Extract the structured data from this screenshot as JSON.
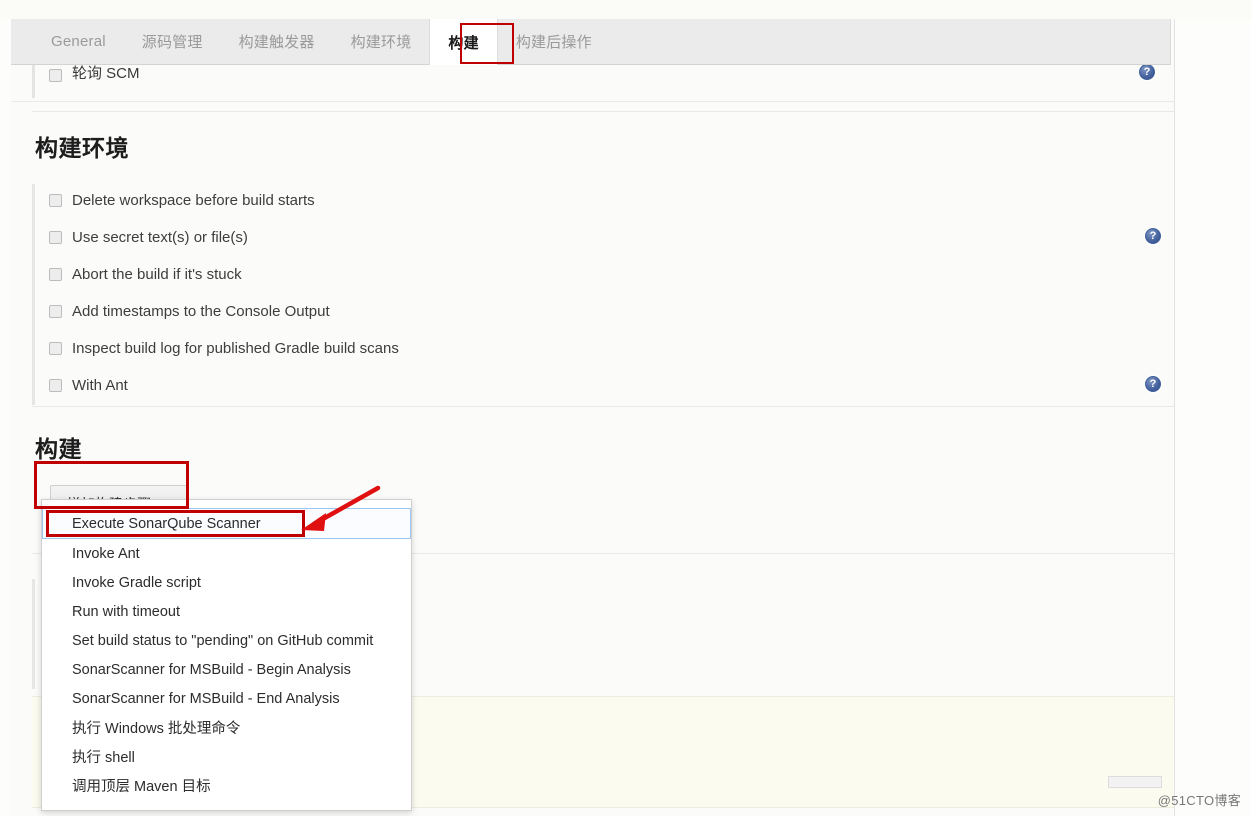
{
  "tabs": [
    {
      "label": "General",
      "active": false
    },
    {
      "label": "源码管理",
      "active": false
    },
    {
      "label": "构建触发器",
      "active": false
    },
    {
      "label": "构建环境",
      "active": false
    },
    {
      "label": "构建",
      "active": true
    },
    {
      "label": "构建后操作",
      "active": false
    }
  ],
  "clipped_row": {
    "label": "轮询 SCM",
    "help_icon": "help-question-icon"
  },
  "sections": {
    "build_environment": {
      "title": "构建环境",
      "checkboxes": [
        {
          "label": "Delete workspace before build starts",
          "checked": false,
          "help": false
        },
        {
          "label": "Use secret text(s) or file(s)",
          "checked": false,
          "help": true
        },
        {
          "label": "Abort the build if it's stuck",
          "checked": false,
          "help": false
        },
        {
          "label": "Add timestamps to the Console Output",
          "checked": false,
          "help": false
        },
        {
          "label": "Inspect build log for published Gradle build scans",
          "checked": false,
          "help": false
        },
        {
          "label": "With Ant",
          "checked": false,
          "help": true
        }
      ]
    },
    "build": {
      "title": "构建",
      "add_step_button": {
        "label": "增加构建步骤",
        "caret_icon": "chevron-down-icon"
      },
      "dropdown_items": [
        {
          "label": "Execute SonarQube Scanner",
          "hovered": true
        },
        {
          "label": "Invoke Ant",
          "hovered": false
        },
        {
          "label": "Invoke Gradle script",
          "hovered": false
        },
        {
          "label": "Run with timeout",
          "hovered": false
        },
        {
          "label": "Set build status to \"pending\" on GitHub commit",
          "hovered": false
        },
        {
          "label": "SonarScanner for MSBuild - Begin Analysis",
          "hovered": false
        },
        {
          "label": "SonarScanner for MSBuild - End Analysis",
          "hovered": false
        },
        {
          "label": "执行 Windows 批处理命令",
          "hovered": false
        },
        {
          "label": "执行 shell",
          "hovered": false
        },
        {
          "label": "调用顶层 Maven 目标",
          "hovered": false
        }
      ]
    }
  },
  "annotations": {
    "color": "#c00000",
    "tab_highlight": "构建",
    "button_highlight": "增加构建步骤",
    "item_highlight": "Execute SonarQube Scanner",
    "arrow_icon": "arrow-pointing-left-down-icon"
  },
  "icons": {
    "help": "?",
    "marker": "⌐"
  },
  "watermark": "@51CTO博客"
}
